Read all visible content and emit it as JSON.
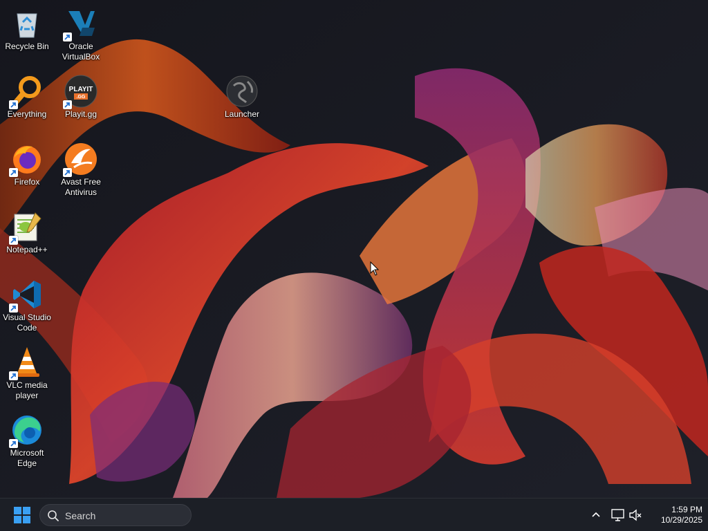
{
  "desktop": {
    "icons": [
      {
        "label": "Recycle Bin",
        "icon": "recycle-bin-icon",
        "shortcut": false
      },
      {
        "label": "Oracle VirtualBox",
        "icon": "virtualbox-icon",
        "shortcut": true
      },
      {
        "label": "Everything",
        "icon": "everything-search-icon",
        "shortcut": true
      },
      {
        "label": "Playit.gg",
        "icon": "playit-gg-icon",
        "shortcut": true,
        "icon_text": "PLAYIT",
        "icon_subtext": ".GG"
      },
      {
        "label": "Launcher",
        "icon": "globe-launcher-icon",
        "shortcut": false
      },
      {
        "label": "Firefox",
        "icon": "firefox-icon",
        "shortcut": true
      },
      {
        "label": "Avast Free Antivirus",
        "icon": "avast-icon",
        "shortcut": true
      },
      {
        "label": "Notepad++",
        "icon": "notepad-plus-plus-icon",
        "shortcut": true
      },
      {
        "label": "Visual Studio Code",
        "icon": "vscode-icon",
        "shortcut": true
      },
      {
        "label": "VLC media player",
        "icon": "vlc-icon",
        "shortcut": true
      },
      {
        "label": "Microsoft Edge",
        "icon": "edge-icon",
        "shortcut": true
      }
    ]
  },
  "taskbar": {
    "start_icon": "windows-start-icon",
    "search_placeholder": "Search",
    "tray": {
      "chevron_icon": "chevron-up-icon",
      "network_icon": "network-icon",
      "volume_icon": "volume-muted-icon"
    },
    "clock": {
      "time": "1:59 PM",
      "date": "10/29/2025"
    }
  },
  "colors": {
    "taskbar_bg": "#1c1f26",
    "search_bg": "#2b2e36",
    "start_blue": "#3aa0f3"
  }
}
